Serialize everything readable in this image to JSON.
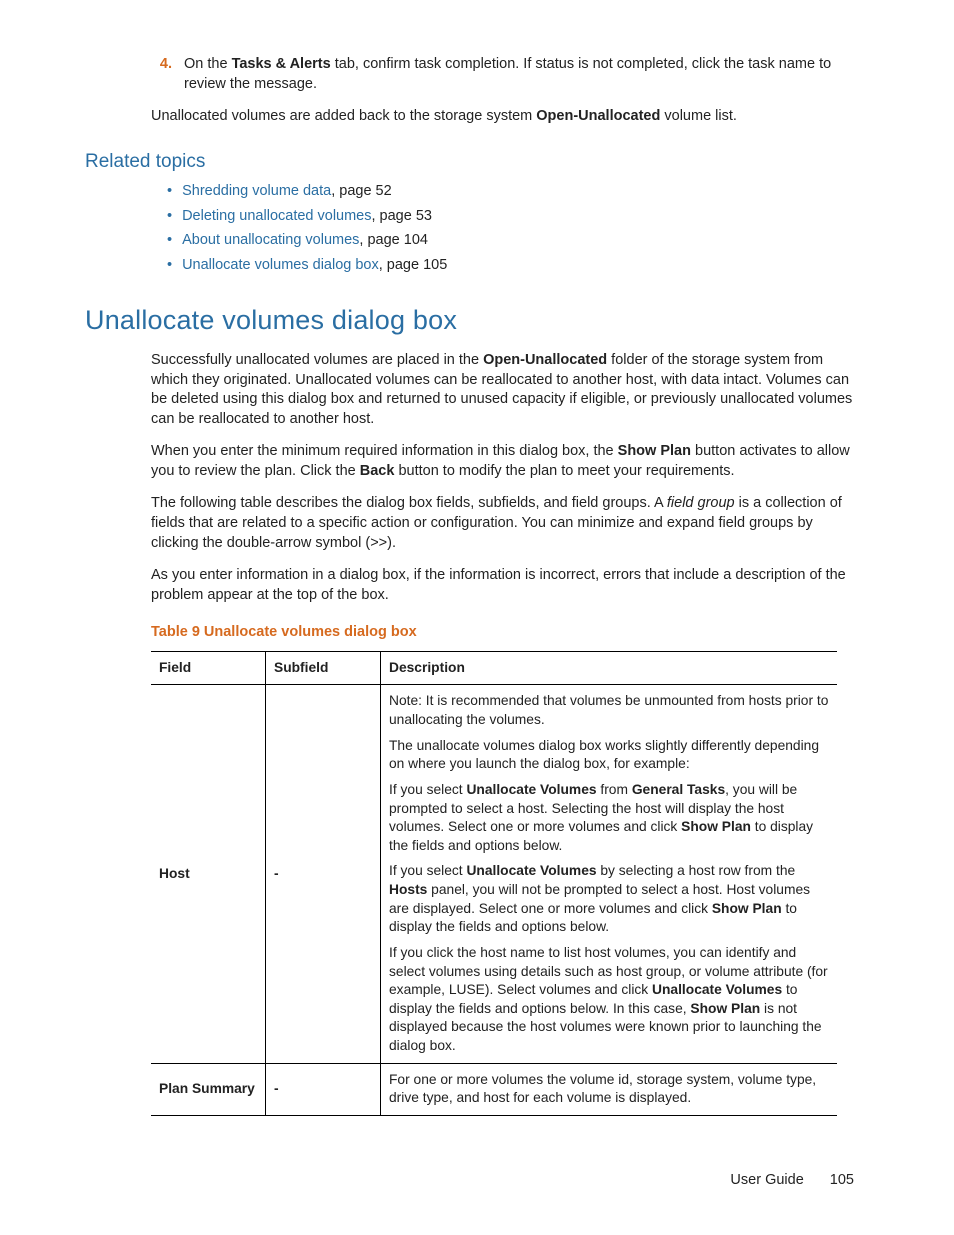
{
  "step": {
    "number": "4.",
    "text_pre": "On the ",
    "tab": "Tasks & Alerts",
    "text_post": " tab, confirm task completion. If status is not completed, click the task name to review the message."
  },
  "after_step": {
    "pre": "Unallocated volumes are added back to the storage system ",
    "bold": "Open-Unallocated",
    "post": " volume list."
  },
  "related_heading": "Related topics",
  "related": [
    {
      "link": "Shredding volume data",
      "rest": ", page 52"
    },
    {
      "link": "Deleting unallocated volumes",
      "rest": ", page 53"
    },
    {
      "link": "About unallocating volumes",
      "rest": ", page 104"
    },
    {
      "link": "Unallocate volumes dialog box",
      "rest": ", page 105"
    }
  ],
  "section_heading": "Unallocate volumes dialog box",
  "para1": {
    "pre": "Successfully unallocated volumes are placed in the ",
    "bold": "Open-Unallocated",
    "post": " folder of the storage system from which they originated. Unallocated volumes can be reallocated to another host, with data intact. Volumes can be deleted using this dialog box and returned to unused capacity if eligible, or previously unallocated volumes can be reallocated to another host."
  },
  "para2": {
    "pre": "When you enter the minimum required information in this dialog box, the ",
    "b1": "Show Plan",
    "mid": " button activates to allow you to review the plan. Click the ",
    "b2": "Back",
    "post": " button to modify the plan to meet your requirements."
  },
  "para3": {
    "pre": "The following table describes the dialog box fields, subfields, and field groups. A ",
    "italic": "field group",
    "post": " is a collection of fields that are related to a specific action or configuration. You can minimize and expand field groups by clicking the double-arrow symbol (>>)."
  },
  "para4": "As you enter information in a dialog box, if the information is incorrect, errors that include a description of the problem appear at the top of the box.",
  "table_caption": "Table 9 Unallocate volumes dialog box",
  "table": {
    "headers": {
      "field": "Field",
      "subfield": "Subfield",
      "description": "Description"
    },
    "rows": [
      {
        "field": "Host",
        "subfield": "-",
        "desc": {
          "p1": "Note: It is recommended that volumes be unmounted from hosts prior to unallocating the volumes.",
          "p2": "The unallocate volumes dialog box works slightly differently depending on where you launch the dialog box, for example:",
          "p3": {
            "pre": "If you select ",
            "b1": "Unallocate Volumes",
            "mid1": " from ",
            "b2": "General Tasks",
            "mid2": ", you will be prompted to select a host. Selecting the host will display the host volumes. Select one or more volumes and click ",
            "b3": "Show Plan",
            "post": " to display the fields and options below."
          },
          "p4": {
            "pre": "If you select ",
            "b1": "Unallocate Volumes",
            "mid1": " by selecting a host row from the ",
            "b2": "Hosts",
            "mid2": " panel, you will not be prompted to select a host. Host volumes are displayed. Select one or more volumes and click ",
            "b3": "Show Plan",
            "post": " to display the fields and options below."
          },
          "p5": {
            "pre": "If you click the host name to list host volumes, you can identify and select volumes using details such as host group, or volume attribute (for example, LUSE). Select volumes and click ",
            "b1": "Unallocate Volumes",
            "mid": " to display the fields and options below. In this case, ",
            "b2": "Show Plan",
            "post": " is not displayed because the host volumes were known prior to launching the dialog box."
          }
        }
      },
      {
        "field": "Plan Summary",
        "subfield": "-",
        "desc_plain": "For one or more volumes the volume id, storage system, volume type, drive type, and host for each volume is displayed."
      }
    ]
  },
  "footer": {
    "title": "User Guide",
    "page": "105"
  }
}
